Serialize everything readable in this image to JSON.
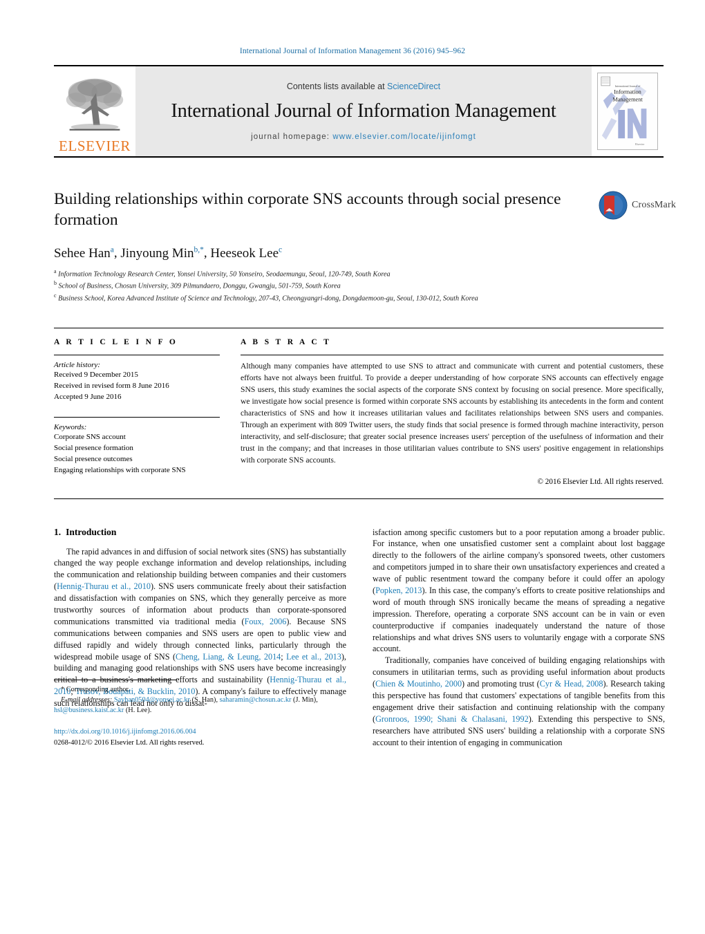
{
  "running_head": "International Journal of Information Management 36 (2016) 945–962",
  "masthead": {
    "publisher_name": "ELSEVIER",
    "contents_prefix": "Contents lists available at",
    "contents_link": "ScienceDirect",
    "journal_title": "International Journal of Information Management",
    "homepage_prefix": "journal homepage:",
    "homepage_url": "www.elsevier.com/locate/ijinfomgt",
    "cover_line1": "International Journal of",
    "cover_line2": "Information",
    "cover_line3": "Management",
    "cover_publisher": "Elsevier"
  },
  "article": {
    "title": "Building relationships within corporate SNS accounts through social presence formation",
    "crossmark_label": "CrossMark",
    "authors": [
      {
        "name": "Sehee Han",
        "sup": "a"
      },
      {
        "name": "Jinyoung Min",
        "sup": "b,*"
      },
      {
        "name": "Heeseok Lee",
        "sup": "c"
      }
    ],
    "affiliations": [
      {
        "marker": "a",
        "text": "Information Technology Research Center, Yonsei University, 50 Yonseiro, Seodaemungu, Seoul, 120-749, South Korea"
      },
      {
        "marker": "b",
        "text": "School of Business, Chosun University, 309 Pilmundaero, Donggu, Gwangju, 501-759, South Korea"
      },
      {
        "marker": "c",
        "text": "Business School, Korea Advanced Institute of Science and Technology, 207-43, Cheongyangri-dong, Dongdaemoon-gu, Seoul, 130-012, South Korea"
      }
    ]
  },
  "article_info": {
    "label": "A R T I C L E   I N F O",
    "history_heading": "Article history:",
    "history": [
      "Received 9 December 2015",
      "Received in revised form 8 June 2016",
      "Accepted 9 June 2016"
    ],
    "keywords_heading": "Keywords:",
    "keywords": [
      "Corporate SNS account",
      "Social presence formation",
      "Social presence outcomes",
      "Engaging relationships with corporate SNS"
    ]
  },
  "abstract": {
    "label": "A B S T R A C T",
    "text": "Although many companies have attempted to use SNS to attract and communicate with current and potential customers, these efforts have not always been fruitful. To provide a deeper understanding of how corporate SNS accounts can effectively engage SNS users, this study examines the social aspects of the corporate SNS context by focusing on social presence. More specifically, we investigate how social presence is formed within corporate SNS accounts by establishing its antecedents in the form and content characteristics of SNS and how it increases utilitarian values and facilitates relationships between SNS users and companies. Through an experiment with 809 Twitter users, the study finds that social presence is formed through machine interactivity, person interactivity, and self-disclosure; that greater social presence increases users' perception of the usefulness of information and their trust in the company; and that increases in those utilitarian values contribute to SNS users' positive engagement in relationships with corporate SNS accounts.",
    "copyright": "© 2016 Elsevier Ltd. All rights reserved."
  },
  "introduction": {
    "number": "1.",
    "heading": "Introduction",
    "left_para1_a": "The rapid advances in and diffusion of social network sites (SNS) has substantially changed the way people exchange information and develop relationships, including the communication and relationship building between companies and their customers (",
    "ref1": "Hennig-Thurau et al., 2010",
    "left_para1_b": "). SNS users communicate freely about their satisfaction and dissatisfaction with companies on SNS, which they generally perceive as more trustworthy sources of information about products than corporate-sponsored communications transmitted via traditional media (",
    "ref2": "Foux, 2006",
    "left_para1_c": "). Because SNS communications between companies and SNS users are open to public view and diffused rapidly and widely through connected links, particularly through the widespread mobile usage of SNS (",
    "ref3": "Cheng, Liang, & Leung, 2014",
    "left_para1_d": "; ",
    "ref4": "Lee et al., 2013",
    "left_para1_e": "), building and managing good relationships with SNS users have become increasingly critical to a business's marketing efforts and sustainability (",
    "ref5": "Hennig-Thurau et al., 2010",
    "left_para1_f": "; ",
    "ref6": "Trusov, Bodapati, & Bucklin, 2010",
    "left_para1_g": "). A company's failure to effectively manage such relationships can lead not only to dissat-",
    "right_para1_a": "isfaction among specific customers but to a poor reputation among a broader public. For instance, when one unsatisfied customer sent a complaint about lost baggage directly to the followers of the airline company's sponsored tweets, other customers and competitors jumped in to share their own unsatisfactory experiences and created a wave of public resentment toward the company before it could offer an apology (",
    "ref7": "Popken, 2013",
    "right_para1_b": "). In this case, the company's efforts to create positive relationships and word of mouth through SNS ironically became the means of spreading a negative impression. Therefore, operating a corporate SNS account can be in vain or even counterproductive if companies inadequately understand the nature of those relationships and what drives SNS users to voluntarily engage with a corporate SNS account.",
    "right_para2_a": "Traditionally, companies have conceived of building engaging relationships with consumers in utilitarian terms, such as providing useful information about products (",
    "ref8": "Chien & Moutinho, 2000",
    "right_para2_b": ") and promoting trust (",
    "ref9": "Cyr & Head, 2008",
    "right_para2_c": "). Research taking this perspective has found that customers' expectations of tangible benefits from this engagement drive their satisfaction and continuing relationship with the company (",
    "ref10": "Gronroos, 1990; Shani & Chalasani, 1992",
    "right_para2_d": "). Extending this perspective to SNS, researchers have attributed SNS users' building a relationship with a corporate SNS account to their intention of engaging in communication"
  },
  "footnote": {
    "corresponding": "* Corresponding author.",
    "email_label": "E-mail addresses:",
    "email1": "Sayhan0504@yonsei.ac.kr",
    "email1_owner": "(S. Han),",
    "email2": "saharamin@chosun.ac.kr",
    "email2_owner": "(J. Min),",
    "email3": "hsl@business.kaist.ac.kr",
    "email3_owner": "(H. Lee).",
    "doi": "http://dx.doi.org/10.1016/j.ijinfomgt.2016.06.004",
    "issn_line": "0268-4012/© 2016 Elsevier Ltd. All rights reserved."
  },
  "colors": {
    "link_blue": "#1c7cb5",
    "header_blue": "#1c6ea4",
    "elsevier_orange": "#E87722",
    "masthead_grey": "#e8e8e8"
  }
}
